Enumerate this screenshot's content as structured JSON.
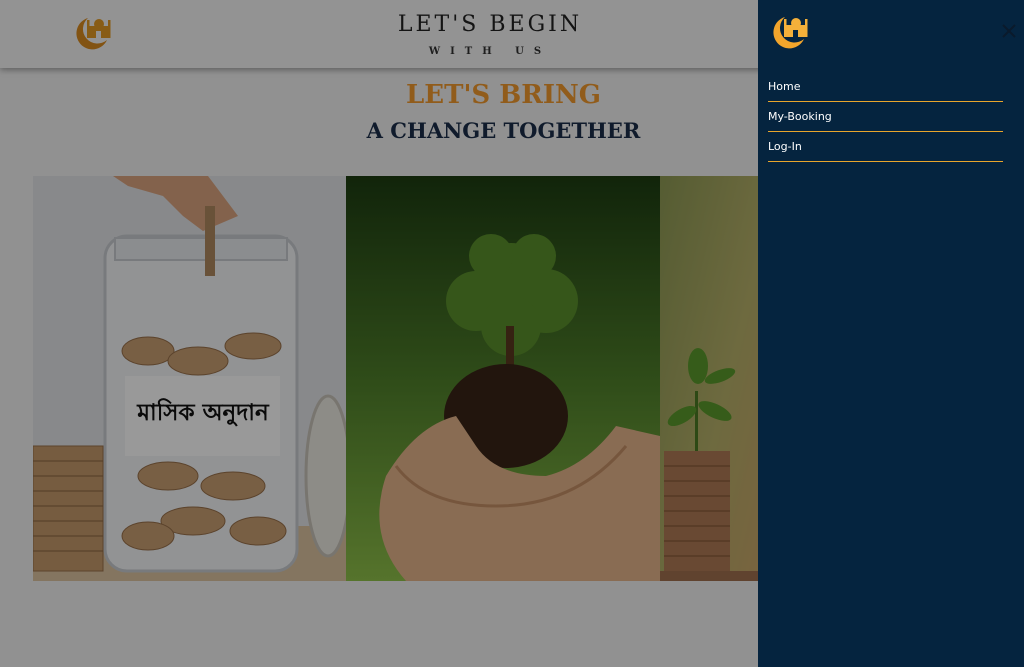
{
  "header": {
    "title": "LET'S BEGIN",
    "subtitle": "WITH US"
  },
  "hero": {
    "line1": "LET'S BRING",
    "line2": "A CHANGE TOGETHER"
  },
  "gallery": {
    "slides": [
      {
        "caption": "মাসিক অনুদান",
        "icon": "coin-jar-image"
      },
      {
        "icon": "sapling-in-hands-image"
      },
      {
        "icon": "plant-on-coins-image"
      }
    ]
  },
  "drawer": {
    "close_icon": "close-icon",
    "nav": [
      {
        "label": "Home"
      },
      {
        "label": "My-Booking"
      },
      {
        "label": "Log-In"
      }
    ]
  },
  "colors": {
    "accent": "#f29a2e",
    "navy": "#1b2e4a",
    "drawer_bg": "#05243f",
    "nav_divider": "#e8a52c"
  }
}
